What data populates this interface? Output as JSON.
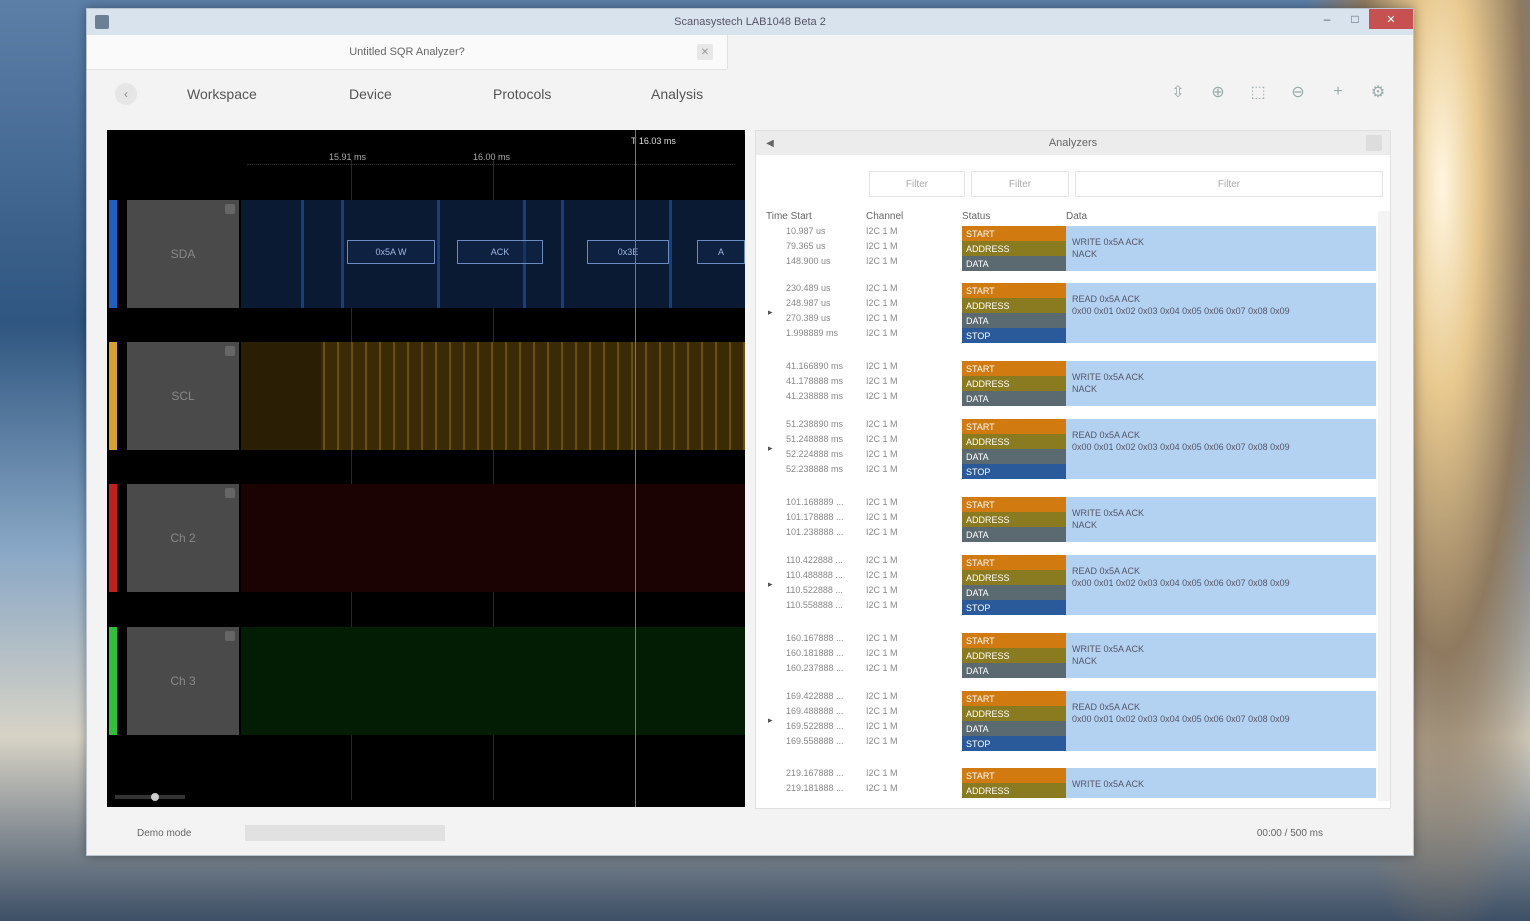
{
  "window": {
    "title": "Scanasystech LAB1048 Beta 2",
    "controls": [
      "–",
      "□",
      "✕"
    ]
  },
  "tabs": [
    {
      "label": "Untitled SQR Analyzer?",
      "close": "✕"
    }
  ],
  "toolbar": {
    "back": "‹",
    "menu": [
      "Workspace",
      "Device",
      "Protocols",
      "Analysis"
    ],
    "icons": [
      "zoom-fit-icon",
      "zoom-in-icon",
      "zoom-select-icon",
      "zoom-out-icon",
      "add-icon",
      "settings-icon"
    ]
  },
  "waveform": {
    "markers": [
      "15.91 ms",
      "16.00 ms",
      "T 16.03 ms"
    ],
    "channels": [
      {
        "name": "SDA",
        "color": "#1f5fc0",
        "bg": "#0b1a33"
      },
      {
        "name": "SCL",
        "color": "#d4a12a",
        "bg": "#3a2a06"
      },
      {
        "name": "Ch 2",
        "color": "#c02020",
        "bg": "#1c0303"
      },
      {
        "name": "Ch 3",
        "color": "#2fbf3a",
        "bg": "#031d05"
      }
    ],
    "packets": [
      "0x5A W",
      "ACK",
      "0x3E",
      "A"
    ]
  },
  "analyzers": {
    "title": "Analyzers",
    "filters": [
      "Filter",
      "Filter",
      "Filter"
    ],
    "columns": [
      "Time Start",
      "Channel",
      "Status",
      "Data"
    ],
    "rows": [
      {
        "arrow": "",
        "times": [
          "10.987 us",
          "79.365 us",
          "148.900 us"
        ],
        "chans": [
          "I2C 1 M",
          "I2C 1 M",
          "I2C 1 M"
        ],
        "statuses": [
          "START",
          "ADDRESS",
          "DATA"
        ],
        "data": [
          "WRITE 0x5A ACK",
          "NACK"
        ]
      },
      {
        "arrow": "▸",
        "times": [
          "230.489 us",
          "248.987 us",
          "270.389 us",
          "1.998889 ms"
        ],
        "chans": [
          "I2C 1 M",
          "I2C 1 M",
          "I2C 1 M",
          "I2C 1 M"
        ],
        "statuses": [
          "START",
          "ADDRESS",
          "DATA",
          "STOP"
        ],
        "data": [
          "READ 0x5A ACK",
          "0x00 0x01 0x02 0x03 0x04 0x05 0x06 0x07 0x08 0x09"
        ]
      },
      {
        "arrow": "",
        "times": [
          "41.166890 ms",
          "41.178888 ms",
          "41.238888 ms"
        ],
        "chans": [
          "I2C 1 M",
          "I2C 1 M",
          "I2C 1 M"
        ],
        "statuses": [
          "START",
          "ADDRESS",
          "DATA"
        ],
        "data": [
          "WRITE 0x5A ACK",
          "NACK"
        ]
      },
      {
        "arrow": "▸",
        "times": [
          "51.238890 ms",
          "51.248888 ms",
          "52.224888 ms",
          "52.238888 ms"
        ],
        "chans": [
          "I2C 1 M",
          "I2C 1 M",
          "I2C 1 M",
          "I2C 1 M"
        ],
        "statuses": [
          "START",
          "ADDRESS",
          "DATA",
          "STOP"
        ],
        "data": [
          "READ 0x5A ACK",
          "0x00 0x01 0x02 0x03 0x04 0x05 0x06 0x07 0x08 0x09"
        ]
      },
      {
        "arrow": "",
        "times": [
          "101.168889 ...",
          "101.178888 ...",
          "101.238888 ..."
        ],
        "chans": [
          "I2C 1 M",
          "I2C 1 M",
          "I2C 1 M"
        ],
        "statuses": [
          "START",
          "ADDRESS",
          "DATA"
        ],
        "data": [
          "WRITE 0x5A ACK",
          "NACK"
        ]
      },
      {
        "arrow": "▸",
        "times": [
          "110.422888 ...",
          "110.488888 ...",
          "110.522888 ...",
          "110.558888 ..."
        ],
        "chans": [
          "I2C 1 M",
          "I2C 1 M",
          "I2C 1 M",
          "I2C 1 M"
        ],
        "statuses": [
          "START",
          "ADDRESS",
          "DATA",
          "STOP"
        ],
        "data": [
          "READ 0x5A ACK",
          "0x00 0x01 0x02 0x03 0x04 0x05 0x06 0x07 0x08 0x09"
        ]
      },
      {
        "arrow": "",
        "times": [
          "160.167888 ...",
          "160.181888 ...",
          "160.237888 ..."
        ],
        "chans": [
          "I2C 1 M",
          "I2C 1 M",
          "I2C 1 M"
        ],
        "statuses": [
          "START",
          "ADDRESS",
          "DATA"
        ],
        "data": [
          "WRITE 0x5A ACK",
          "NACK"
        ]
      },
      {
        "arrow": "▸",
        "times": [
          "169.422888 ...",
          "169.488888 ...",
          "169.522888 ...",
          "169.558888 ..."
        ],
        "chans": [
          "I2C 1 M",
          "I2C 1 M",
          "I2C 1 M",
          "I2C 1 M"
        ],
        "statuses": [
          "START",
          "ADDRESS",
          "DATA",
          "STOP"
        ],
        "data": [
          "READ 0x5A ACK",
          "0x00 0x01 0x02 0x03 0x04 0x05 0x06 0x07 0x08 0x09"
        ]
      },
      {
        "arrow": "",
        "times": [
          "219.167888 ...",
          "219.181888 ..."
        ],
        "chans": [
          "I2C 1 M",
          "I2C 1 M"
        ],
        "statuses": [
          "START",
          "ADDRESS"
        ],
        "data": [
          "WRITE 0x5A ACK"
        ]
      }
    ]
  },
  "status_colors": {
    "START": "#d07a10",
    "ADDRESS": "#8a7a20",
    "DATA": "#5a6a70",
    "STOP": "#2a5a9a"
  },
  "statusbar": {
    "left": "Demo mode",
    "right": "00:00 / 500 ms"
  }
}
